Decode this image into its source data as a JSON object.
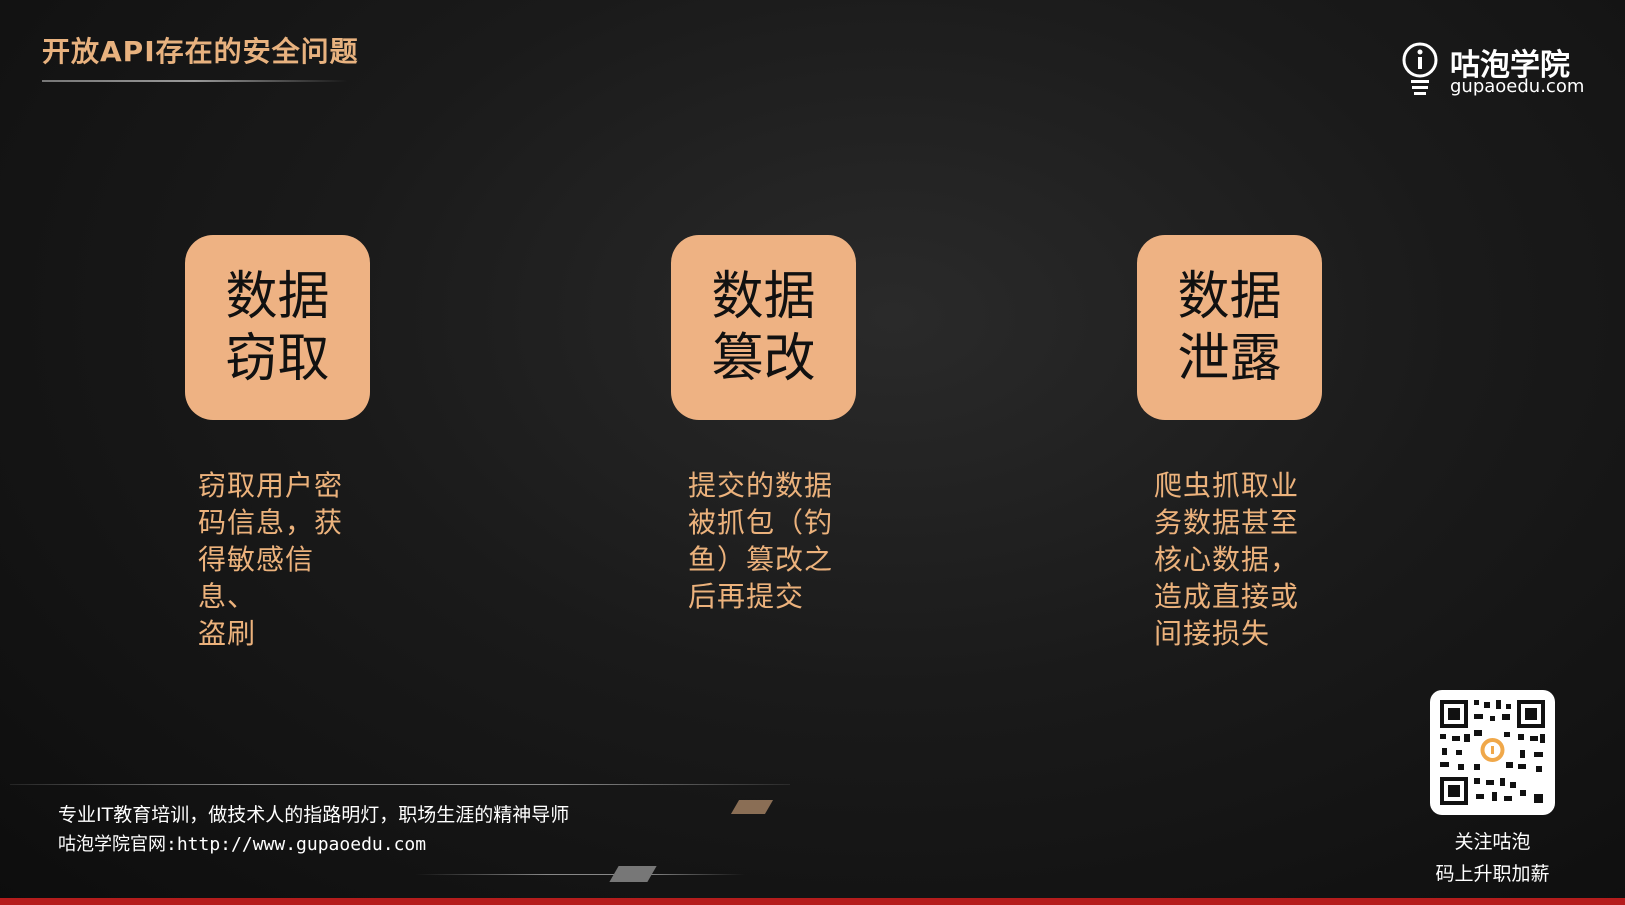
{
  "slide": {
    "title": "开放API存在的安全问题"
  },
  "logo": {
    "name": "咕泡学院",
    "domain": "gupaoedu.com",
    "icon": "bulb-icon"
  },
  "cards": [
    {
      "line1": "数据",
      "line2": "窃取"
    },
    {
      "line1": "数据",
      "line2": "篡改"
    },
    {
      "line1": "数据",
      "line2": "泄露"
    }
  ],
  "descriptions": [
    {
      "lines": [
        "窃取用户密",
        "码信息，获",
        "得敏感信息、",
        "盗刷"
      ]
    },
    {
      "lines": [
        "提交的数据",
        "被抓包（钓",
        "鱼）篡改之",
        "后再提交"
      ]
    },
    {
      "lines": [
        "爬虫抓取业",
        "务数据甚至",
        "核心数据，",
        "造成直接或",
        "间接损失"
      ]
    }
  ],
  "footer": {
    "slogan": "专业IT教育培训，做技术人的指路明灯，职场生涯的精神导师",
    "website": "咕泡学院官网:http://www.gupaoedu.com"
  },
  "qr": {
    "caption_line1": "关注咕泡",
    "caption_line2": "码上升职加薪"
  },
  "colors": {
    "accent": "#eeb283",
    "title": "#e8b27f",
    "bottom_bar": "#b51c1c"
  }
}
